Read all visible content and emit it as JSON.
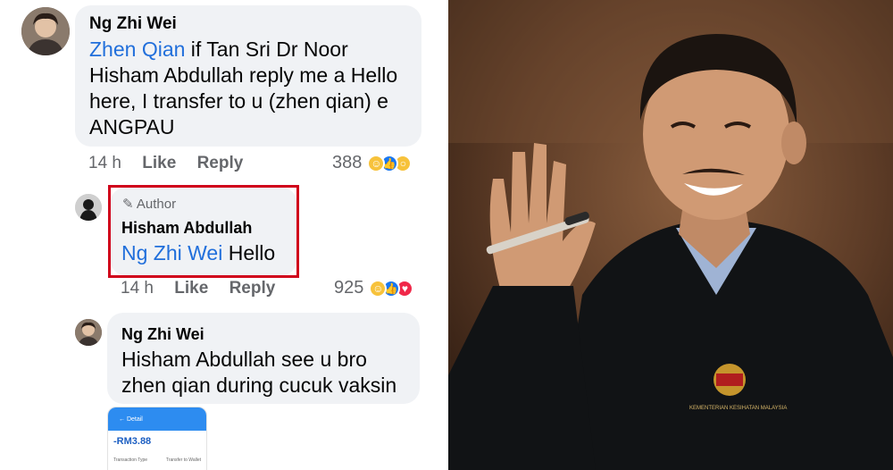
{
  "comments": [
    {
      "author": "Ng Zhi Wei",
      "mention": "Zhen Qian",
      "lines": [
        " if Tan Sri Dr Noor",
        "Hisham Abdullah reply me a Hello",
        "here, I transfer to u (zhen qian) e",
        "ANGPAU"
      ],
      "time": "14 h",
      "like_label": "Like",
      "reply_label": "Reply",
      "reaction_count": "388",
      "reactions": [
        "haha-icon",
        "like-icon",
        "wow-icon"
      ]
    },
    {
      "badge_label": "Author",
      "author": "Hisham Abdullah",
      "mention": "Ng Zhi Wei",
      "text": " Hello",
      "time": "14 h",
      "like_label": "Like",
      "reply_label": "Reply",
      "reaction_count": "925",
      "reactions": [
        "haha-icon",
        "like-icon",
        "love-icon"
      ],
      "highlight_color": "#d0021b"
    },
    {
      "author": "Ng Zhi Wei",
      "lines": [
        "Hisham Abdullah see u bro",
        "zhen qian during cucuk vaksin"
      ],
      "attachment": {
        "header": "Detail",
        "amount": "-RM3.88",
        "row_label": "Transaction Type",
        "row_value": "Transfer to Wallet"
      }
    }
  ],
  "photo": {
    "jacket_text": "KEMENTERIAN KESIHATAN MALAYSIA"
  },
  "colors": {
    "mention": "#216fdb",
    "bubble": "#f0f2f5",
    "meta": "#65676b"
  }
}
